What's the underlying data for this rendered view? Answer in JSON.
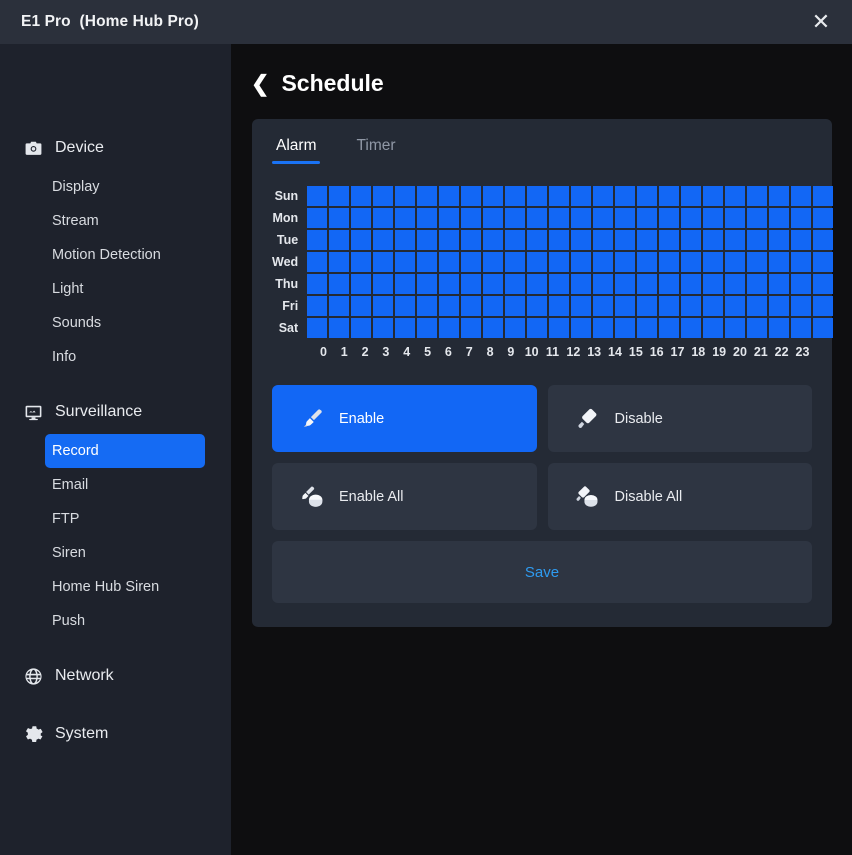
{
  "titlebar": {
    "title": "E1 Pro  (Home Hub Pro)",
    "close_icon": "close-icon",
    "close_glyph": "✕"
  },
  "sidebar": {
    "groups": [
      {
        "label": "Device",
        "icon": "camera-icon",
        "items": [
          {
            "label": "Display",
            "active": false
          },
          {
            "label": "Stream",
            "active": false
          },
          {
            "label": "Motion Detection",
            "active": false
          },
          {
            "label": "Light",
            "active": false
          },
          {
            "label": "Sounds",
            "active": false
          },
          {
            "label": "Info",
            "active": false
          }
        ]
      },
      {
        "label": "Surveillance",
        "icon": "monitor-icon",
        "items": [
          {
            "label": "Record",
            "active": true
          },
          {
            "label": "Email",
            "active": false
          },
          {
            "label": "FTP",
            "active": false
          },
          {
            "label": "Siren",
            "active": false
          },
          {
            "label": "Home Hub Siren",
            "active": false
          },
          {
            "label": "Push",
            "active": false
          }
        ]
      },
      {
        "label": "Network",
        "icon": "globe-icon",
        "items": []
      },
      {
        "label": "System",
        "icon": "gear-icon",
        "items": []
      }
    ]
  },
  "page": {
    "back_icon": "chevron-left-icon",
    "back_glyph": "❮",
    "title": "Schedule"
  },
  "tabs": [
    {
      "label": "Alarm",
      "active": true
    },
    {
      "label": "Timer",
      "active": false
    }
  ],
  "schedule": {
    "days": [
      "Sun",
      "Mon",
      "Tue",
      "Wed",
      "Thu",
      "Fri",
      "Sat"
    ],
    "hours": [
      "0",
      "1",
      "2",
      "3",
      "4",
      "5",
      "6",
      "7",
      "8",
      "9",
      "10",
      "11",
      "12",
      "13",
      "14",
      "15",
      "16",
      "17",
      "18",
      "19",
      "20",
      "21",
      "22",
      "23"
    ],
    "cells": [
      [
        1,
        1,
        1,
        1,
        1,
        1,
        1,
        1,
        1,
        1,
        1,
        1,
        1,
        1,
        1,
        1,
        1,
        1,
        1,
        1,
        1,
        1,
        1,
        1
      ],
      [
        1,
        1,
        1,
        1,
        1,
        1,
        1,
        1,
        1,
        1,
        1,
        1,
        1,
        1,
        1,
        1,
        1,
        1,
        1,
        1,
        1,
        1,
        1,
        1
      ],
      [
        1,
        1,
        1,
        1,
        1,
        1,
        1,
        1,
        1,
        1,
        1,
        1,
        1,
        1,
        1,
        1,
        1,
        1,
        1,
        1,
        1,
        1,
        1,
        1
      ],
      [
        1,
        1,
        1,
        1,
        1,
        1,
        1,
        1,
        1,
        1,
        1,
        1,
        1,
        1,
        1,
        1,
        1,
        1,
        1,
        1,
        1,
        1,
        1,
        1
      ],
      [
        1,
        1,
        1,
        1,
        1,
        1,
        1,
        1,
        1,
        1,
        1,
        1,
        1,
        1,
        1,
        1,
        1,
        1,
        1,
        1,
        1,
        1,
        1,
        1
      ],
      [
        1,
        1,
        1,
        1,
        1,
        1,
        1,
        1,
        1,
        1,
        1,
        1,
        1,
        1,
        1,
        1,
        1,
        1,
        1,
        1,
        1,
        1,
        1,
        1
      ],
      [
        1,
        1,
        1,
        1,
        1,
        1,
        1,
        1,
        1,
        1,
        1,
        1,
        1,
        1,
        1,
        1,
        1,
        1,
        1,
        1,
        1,
        1,
        1,
        1
      ]
    ],
    "active_color": "#1267f5",
    "inactive_color": "#353c49"
  },
  "actions": [
    {
      "label": "Enable",
      "icon": "paintbrush-icon",
      "selected": true
    },
    {
      "label": "Disable",
      "icon": "eraser-icon",
      "selected": false
    },
    {
      "label": "Enable All",
      "icon": "paintbrush-all-icon",
      "selected": false
    },
    {
      "label": "Disable All",
      "icon": "eraser-all-icon",
      "selected": false
    }
  ],
  "save": {
    "label": "Save",
    "color": "#2e9bf0"
  },
  "theme": {
    "accent": "#1267f5",
    "panel_bg": "#242a35",
    "sidebar_bg": "#1e222c",
    "titlebar_bg": "#2b303b",
    "page_bg": "#0e0e10",
    "button_bg": "#2e3542"
  }
}
